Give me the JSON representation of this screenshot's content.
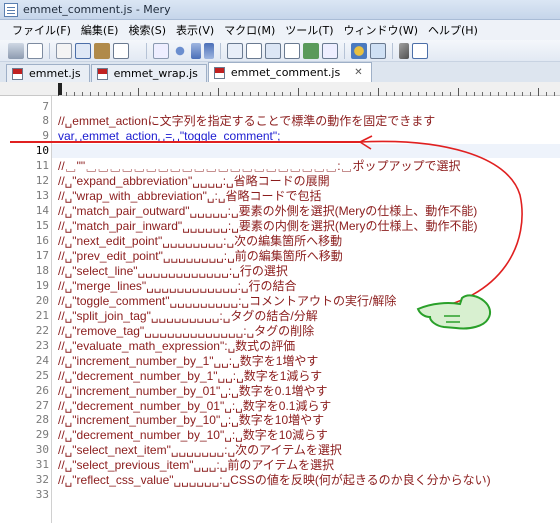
{
  "window": {
    "title": "emmet_comment.js - Mery"
  },
  "menu": [
    "ファイル(F)",
    "編集(E)",
    "検索(S)",
    "表示(V)",
    "マクロ(M)",
    "ツール(T)",
    "ウィンドウ(W)",
    "ヘルプ(H)"
  ],
  "tabs": [
    {
      "label": "emmet.js",
      "active": false
    },
    {
      "label": "emmet_wrap.js",
      "active": false
    },
    {
      "label": "emmet_comment.js",
      "active": true,
      "close": "✕"
    }
  ],
  "editor": {
    "lines": [
      {
        "n": "7",
        "text": ""
      },
      {
        "n": "8",
        "text": "//␣emmet_actionに文字列を指定することで標準の動作を固定できます"
      },
      {
        "n": "9",
        "text": "var␣emmet_action␣=␣\"toggle_comment\";"
      },
      {
        "n": "10",
        "text": ""
      },
      {
        "n": "11",
        "text": "//␣\"\"␣␣␣␣␣␣␣␣␣␣␣␣␣␣␣␣␣␣␣␣␣:␣ポップアップで選択"
      },
      {
        "n": "12",
        "text": "//␣\"expand_abbreviation\"␣␣␣␣:␣省略コードの展開"
      },
      {
        "n": "13",
        "text": "//␣\"wrap_with_abbreviation\"␣:␣省略コードで包括"
      },
      {
        "n": "14",
        "text": "//␣\"match_pair_outward\"␣␣␣␣␣:␣要素の外側を選択(Meryの仕様上、動作不能)"
      },
      {
        "n": "15",
        "text": "//␣\"match_pair_inward\"␣␣␣␣␣␣:␣要素の内側を選択(Meryの仕様上、動作不能)"
      },
      {
        "n": "16",
        "text": "//␣\"next_edit_point\"␣␣␣␣␣␣␣␣:␣次の編集箇所へ移動"
      },
      {
        "n": "17",
        "text": "//␣\"prev_edit_point\"␣␣␣␣␣␣␣␣:␣前の編集箇所へ移動"
      },
      {
        "n": "18",
        "text": "//␣\"select_line\"␣␣␣␣␣␣␣␣␣␣␣␣:␣行の選択"
      },
      {
        "n": "19",
        "text": "//␣\"merge_lines\"␣␣␣␣␣␣␣␣␣␣␣␣:␣行の結合"
      },
      {
        "n": "20",
        "text": "//␣\"toggle_comment\"␣␣␣␣␣␣␣␣␣:␣コメントアウトの実行/解除"
      },
      {
        "n": "21",
        "text": "//␣\"split_join_tag\"␣␣␣␣␣␣␣␣␣:␣タグの結合/分解"
      },
      {
        "n": "22",
        "text": "//␣\"remove_tag\"␣␣␣␣␣␣␣␣␣␣␣␣␣:␣タグの削除"
      },
      {
        "n": "23",
        "text": "//␣\"evaluate_math_expression\":␣数式の評価"
      },
      {
        "n": "24",
        "text": "//␣\"increment_number_by_1\"␣␣:␣数字を1増やす"
      },
      {
        "n": "25",
        "text": "//␣\"decrement_number_by_1\"␣␣:␣数字を1減らす"
      },
      {
        "n": "26",
        "text": "//␣\"increment_number_by_01\"␣:␣数字を0.1増やす"
      },
      {
        "n": "27",
        "text": "//␣\"decrement_number_by_01\"␣:␣数字を0.1減らす"
      },
      {
        "n": "28",
        "text": "//␣\"increment_number_by_10\"␣:␣数字を10増やす"
      },
      {
        "n": "29",
        "text": "//␣\"decrement_number_by_10\"␣:␣数字を10減らす"
      },
      {
        "n": "30",
        "text": "//␣\"select_next_item\"␣␣␣␣␣␣␣:␣次のアイテムを選択"
      },
      {
        "n": "31",
        "text": "//␣\"select_previous_item\"␣␣␣:␣前のアイテムを選択"
      },
      {
        "n": "32",
        "text": "//␣\"reflect_css_value\"␣␣␣␣␣␣:␣CSSの値を反映(何が起きるのか良く分からない)"
      },
      {
        "n": "33",
        "text": ""
      }
    ],
    "current_line": "10",
    "blue_line": "9"
  },
  "colors": {
    "comment": "#8b1c1c",
    "keyword_line": "#1a1ad0",
    "annotation_red": "#e02020",
    "annotation_green": "#2aa02a"
  }
}
